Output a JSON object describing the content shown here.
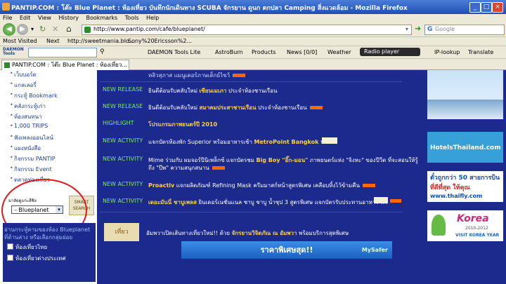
{
  "window": {
    "title": "PANTIP.COM : โต๊ะ Blue Planet : ห้องเที่ยว บันทึกนักเดินทาง SCUBA จักรยาน ดูนก ตกปลา Camping สิ่งแวดล้อม - Mozilla Firefox"
  },
  "menu": [
    "File",
    "Edit",
    "View",
    "History",
    "Bookmarks",
    "Tools",
    "Help"
  ],
  "nav": {
    "url": "http://www.pantip.com/cafe/blueplanet/",
    "search_placeholder": "Google"
  },
  "bookmarks": [
    "Most Visited",
    "Next",
    "http://sweetmania.blo...",
    "Sony%20Ericsson%2..."
  ],
  "daemon_toolbar": {
    "logo": "DAEMON Tools",
    "items": [
      "DAEMON Tools Lite",
      "AstroBurn",
      "Products",
      "News [0/0]",
      "Weather",
      "Radio player",
      "IP-lookup",
      "Translate"
    ]
  },
  "tab": {
    "label": "PANTIP.COM : โต๊ะ Blue Planet : ห้องเที่ยว..."
  },
  "sidebar": {
    "links": [
      "เว็บบอร์ด",
      "แกลเลอรี่",
      "กระทู้ Bookmark",
      "คลังกระทู้เก่า",
      "ห้องสนทนา",
      "1,000 TRIPS",
      "ฟังเพลงออนไลน์",
      "แผงหนังสือ",
      "กิจกรรม PANTIP",
      "กิจกรรม Event",
      "ตลาดท่องเที่ยว"
    ],
    "search_label": "มาลัยดูแกะสีชิง",
    "select_value": "- Blueplanet",
    "smart_search": "SMART SEARCH",
    "info_text": "อ่านกระทู้ตามของห้อง Blueplanet ที่ด้านล่าง หรือเลือกกลุ่มย่อย",
    "checkboxes": [
      "ห้องเที่ยวไทย",
      "ห้องเที่ยวต่างประเทศ"
    ]
  },
  "news": [
    {
      "category": "",
      "text": "หลิวสุภาส แมนูเดอร์ภาษเด็กย์ไขว้",
      "highlight": ""
    },
    {
      "category": "NEW RELEASE",
      "text": "ยินดีต้อนรับคลับใหม่ ",
      "highlight": "เซียนเมเภา",
      "tail": " ประจำห้องชานเรือน"
    },
    {
      "category": "NEW RELEASE",
      "text": "ยินดีต้อนรับคลับใหม่ ",
      "highlight": "สมาคมประสาชานเรือน",
      "tail": " ประจำห้องชานเรือน"
    },
    {
      "category": "HIGHLIGHT",
      "text": "",
      "highlight": "โปรแกรมภาพยนตร์ปี 2010",
      "tail": ""
    },
    {
      "category": "NEW ACTIVITY",
      "text": "แจกบัตรห้องพัก Superior พร้อมอาหารเช้า ",
      "highlight": "MetroPoint Bangkok",
      "tail": " ฟรี"
    },
    {
      "category": "NEW ACTIVITY",
      "text": "Mime ร่วมกับ ผมจอร์ปีนิเพล็กซ์ แจกบัตรชม ",
      "highlight": "Big Boy \"อิ๊ก-มอน\"",
      "tail": " ภาพยนตร์แห่ง \"จิงหะ\" ของปีวีต ที่จะสอนให้รู้"
    },
    {
      "category": "",
      "text": "ถึง \"ปีพ\" ความสนุกสนาน",
      "highlight": "",
      "tail": ""
    },
    {
      "category": "NEW ACTIVITY",
      "text": "",
      "highlight": "Proactiv",
      "tail": " แจกผลิตภัณฑ์ Refining Mask ครีมมาสก์หน้าสูตรพิเศษ เคลือบทิ้งไว้ข้ามคืน"
    },
    {
      "category": "NEW ACTIVITY",
      "text": "",
      "highlight": "เดอะมันนี่ ชาบูเพลส",
      "tail": " ยินเดอร์เนชั่นแนล ชาบู ชาบู น้ำซุป 3 สูตรพิเศษ แจกบัตรรับประทานอาหาร ฟรี"
    }
  ],
  "promo": {
    "label": "เที่ยว",
    "text": "อัมพวาเปิดเส้นทางเที่ยวใหม่!! ด้วย ",
    "highlight": "จักรยานวิจิตภัณ ณ อัมพวา",
    "tail": " พร้อมบริการสุดพิเศษ"
  },
  "ads": {
    "hotels": "HotelsThailand.com",
    "thaifly_title": "ตั๋วถูกกว่า 50 สายการบิน",
    "thaifly_sub": "ที่ดีที่สุด ให้คุณ",
    "thaifly_url": "www.thaifly.com",
    "korea_title": "Korea",
    "korea_years": "2010-2012",
    "korea_sub": "VISIT KOREA YEAR",
    "bottom_banner": "ราคาพิเศษสุด!!",
    "bottom_brand": "MySafer"
  }
}
